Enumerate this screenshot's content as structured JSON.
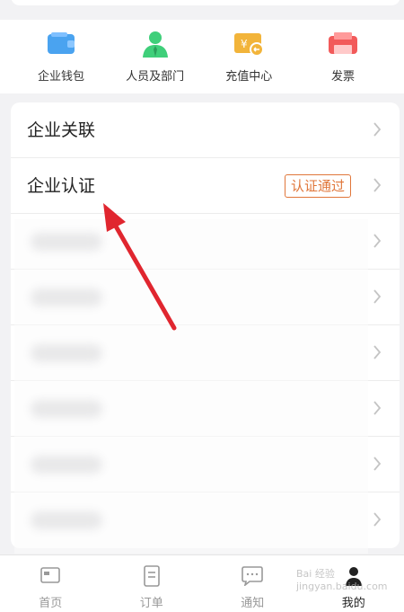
{
  "quick_actions": [
    {
      "label": "企业钱包",
      "icon": "wallet-icon"
    },
    {
      "label": "人员及部门",
      "icon": "people-department-icon"
    },
    {
      "label": "充值中心",
      "icon": "recharge-icon"
    },
    {
      "label": "发票",
      "icon": "invoice-icon"
    }
  ],
  "list": {
    "rows": [
      {
        "title": "企业关联"
      },
      {
        "title": "企业认证",
        "badge": "认证通过"
      }
    ]
  },
  "bottom_nav": [
    {
      "label": "首页",
      "icon": "home-icon"
    },
    {
      "label": "订单",
      "icon": "order-icon"
    },
    {
      "label": "通知",
      "icon": "notification-icon"
    },
    {
      "label": "我的",
      "icon": "profile-icon",
      "active": true
    }
  ],
  "watermark": "Bai 经验 jingyan.baidu.com",
  "colors": {
    "badge": "#e0763a",
    "annotation_arrow": "#e0262f",
    "wallet": "#4aa3f0",
    "people": "#3fcf7a",
    "recharge": "#f2b43a",
    "invoice": "#f25a5a"
  }
}
